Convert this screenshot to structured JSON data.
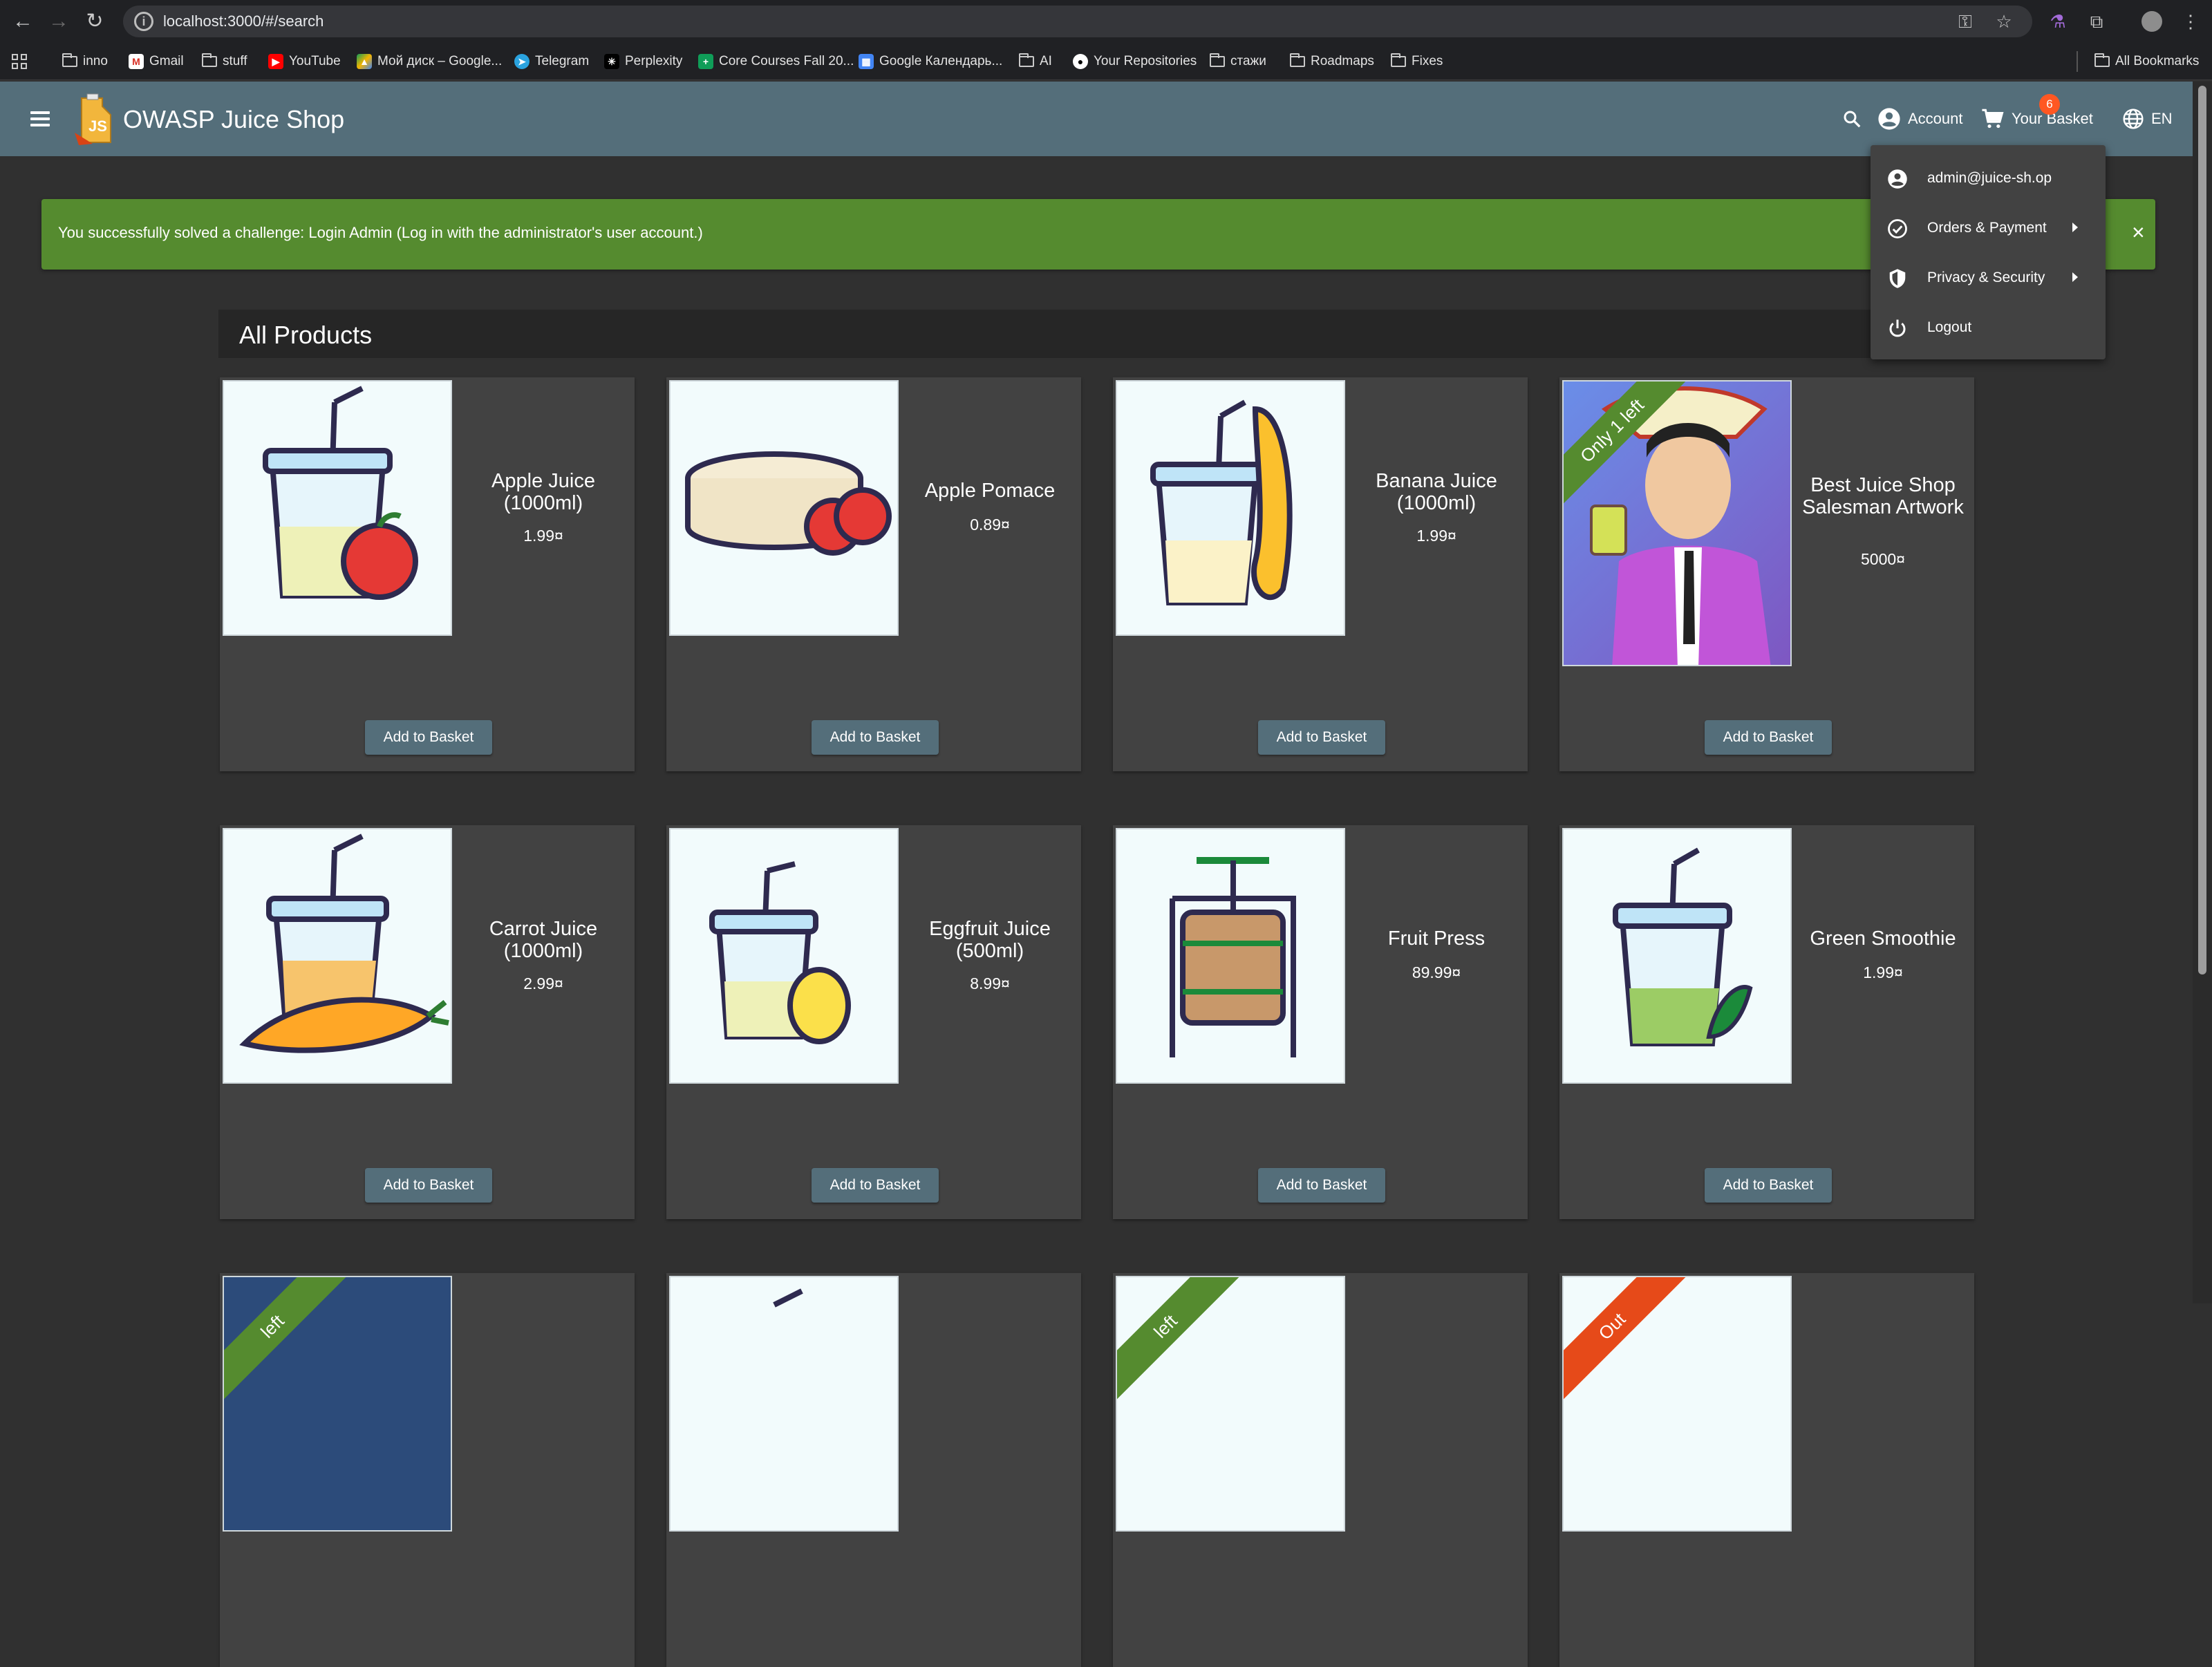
{
  "browser": {
    "url": "localhost:3000/#/search",
    "bookmarks": [
      {
        "label": "inno",
        "icon": "folder-icon"
      },
      {
        "label": "Gmail",
        "icon": "gmail-icon"
      },
      {
        "label": "stuff",
        "icon": "folder-icon"
      },
      {
        "label": "YouTube",
        "icon": "youtube-icon"
      },
      {
        "label": "Мой диск – Google...",
        "icon": "google-drive-icon"
      },
      {
        "label": "Telegram",
        "icon": "telegram-icon"
      },
      {
        "label": "Perplexity",
        "icon": "perplexity-icon"
      },
      {
        "label": "Core Courses Fall 20...",
        "icon": "sheets-icon"
      },
      {
        "label": "Google Календарь...",
        "icon": "calendar-icon"
      },
      {
        "label": "AI",
        "icon": "folder-icon"
      },
      {
        "label": "Your Repositories",
        "icon": "github-icon"
      },
      {
        "label": "стажи",
        "icon": "folder-icon"
      },
      {
        "label": "Roadmaps",
        "icon": "folder-icon"
      },
      {
        "label": "Fixes",
        "icon": "folder-icon"
      }
    ],
    "all_bookmarks": "All Bookmarks"
  },
  "toolbar": {
    "title": "OWASP Juice Shop",
    "logo_text": "JS",
    "account_label": "Account",
    "basket_label": "Your Basket",
    "basket_count": "6",
    "language": "EN"
  },
  "notification": {
    "message": "You successfully solved a challenge: Login Admin (Log in with the administrator's user account.)",
    "close": "×"
  },
  "products_heading": "All Products",
  "products": [
    {
      "name": "Apple Juice (1000ml)",
      "price": "1.99¤",
      "add": "Add to Basket",
      "ribbon": ""
    },
    {
      "name": "Apple Pomace",
      "price": "0.89¤",
      "add": "Add to Basket",
      "ribbon": ""
    },
    {
      "name": "Banana Juice (1000ml)",
      "price": "1.99¤",
      "add": "Add to Basket",
      "ribbon": ""
    },
    {
      "name": "Best Juice Shop Salesman Artwork",
      "price": "5000¤",
      "add": "Add to Basket",
      "ribbon": "Only 1 left"
    },
    {
      "name": "Carrot Juice (1000ml)",
      "price": "2.99¤",
      "add": "Add to Basket",
      "ribbon": ""
    },
    {
      "name": "Eggfruit Juice (500ml)",
      "price": "8.99¤",
      "add": "Add to Basket",
      "ribbon": ""
    },
    {
      "name": "Fruit Press",
      "price": "89.99¤",
      "add": "Add to Basket",
      "ribbon": ""
    },
    {
      "name": "Green Smoothie",
      "price": "1.99¤",
      "add": "Add to Basket",
      "ribbon": ""
    }
  ],
  "partial_ribbons": [
    "left",
    "left",
    "Out"
  ],
  "account_menu": {
    "email": "admin@juice-sh.op",
    "orders": "Orders & Payment",
    "privacy": "Privacy & Security",
    "logout": "Logout"
  },
  "colors": {
    "toolbar": "#546e7a",
    "success": "#558b2f",
    "card": "#424242",
    "background": "#303030",
    "badge": "#ff5722"
  }
}
